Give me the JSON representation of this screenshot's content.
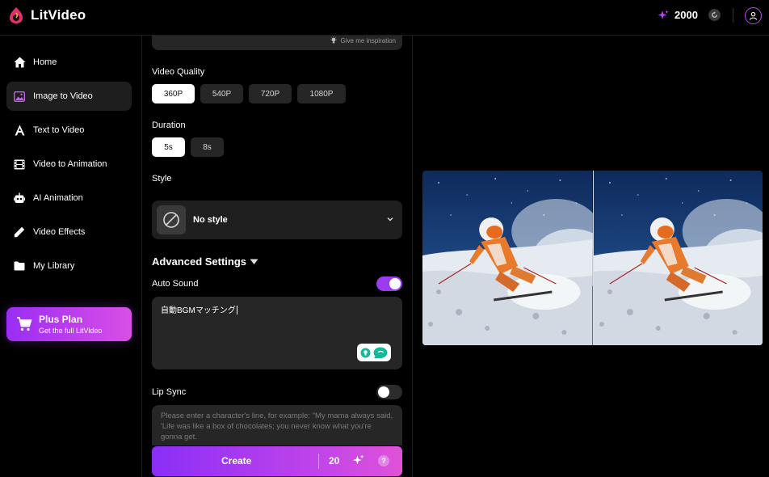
{
  "header": {
    "brand": "LitVideo",
    "credits": "2000",
    "sparkle_icon": "sparkle-icon",
    "refresh_icon": "refresh-icon",
    "user_icon": "user-icon"
  },
  "sidebar": {
    "items": [
      {
        "label": "Home",
        "icon": "home-icon"
      },
      {
        "label": "Image to Video",
        "icon": "image-icon"
      },
      {
        "label": "Text to Video",
        "icon": "text-icon"
      },
      {
        "label": "Video to Animation",
        "icon": "film-icon"
      },
      {
        "label": "AI Animation",
        "icon": "robot-icon"
      },
      {
        "label": "Video Effects",
        "icon": "wand-icon"
      },
      {
        "label": "My Library",
        "icon": "folder-icon"
      }
    ],
    "active": "Image to Video",
    "plus": {
      "title": "Plus Plan",
      "subtitle": "Get the full LitVideo"
    }
  },
  "panel": {
    "inspiration": "Give me inspiration",
    "quality": {
      "label": "Video Quality",
      "options": [
        "360P",
        "540P",
        "720P",
        "1080P"
      ],
      "selected": "360P"
    },
    "duration": {
      "label": "Duration",
      "options": [
        "5s",
        "8s"
      ],
      "selected": "5s"
    },
    "style": {
      "label": "Style",
      "value": "No style"
    },
    "advanced": "Advanced Settings",
    "auto_sound": {
      "label": "Auto Sound",
      "on": true,
      "text": "自動BGMマッチング"
    },
    "lip_sync": {
      "label": "Lip Sync",
      "on": false,
      "placeholder": "Please enter a character's line, for example: \"My mama always said, 'Life was like a box of chocolates; you never know what you're gonna get."
    },
    "create": {
      "label": "Create",
      "cost": "20",
      "help": "?"
    }
  },
  "colors": {
    "accent": "#9c3cf0",
    "gradient_end": "#e052d8",
    "panel_bg": "#262626"
  }
}
